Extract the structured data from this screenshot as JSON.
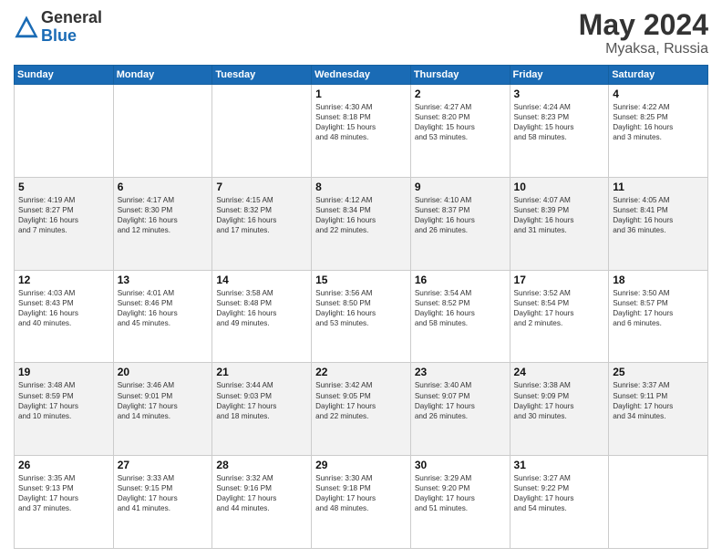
{
  "header": {
    "logo_general": "General",
    "logo_blue": "Blue",
    "month_year": "May 2024",
    "location": "Myaksa, Russia"
  },
  "days_of_week": [
    "Sunday",
    "Monday",
    "Tuesday",
    "Wednesday",
    "Thursday",
    "Friday",
    "Saturday"
  ],
  "weeks": [
    [
      {
        "day": "",
        "info": ""
      },
      {
        "day": "",
        "info": ""
      },
      {
        "day": "",
        "info": ""
      },
      {
        "day": "1",
        "info": "Sunrise: 4:30 AM\nSunset: 8:18 PM\nDaylight: 15 hours\nand 48 minutes."
      },
      {
        "day": "2",
        "info": "Sunrise: 4:27 AM\nSunset: 8:20 PM\nDaylight: 15 hours\nand 53 minutes."
      },
      {
        "day": "3",
        "info": "Sunrise: 4:24 AM\nSunset: 8:23 PM\nDaylight: 15 hours\nand 58 minutes."
      },
      {
        "day": "4",
        "info": "Sunrise: 4:22 AM\nSunset: 8:25 PM\nDaylight: 16 hours\nand 3 minutes."
      }
    ],
    [
      {
        "day": "5",
        "info": "Sunrise: 4:19 AM\nSunset: 8:27 PM\nDaylight: 16 hours\nand 7 minutes."
      },
      {
        "day": "6",
        "info": "Sunrise: 4:17 AM\nSunset: 8:30 PM\nDaylight: 16 hours\nand 12 minutes."
      },
      {
        "day": "7",
        "info": "Sunrise: 4:15 AM\nSunset: 8:32 PM\nDaylight: 16 hours\nand 17 minutes."
      },
      {
        "day": "8",
        "info": "Sunrise: 4:12 AM\nSunset: 8:34 PM\nDaylight: 16 hours\nand 22 minutes."
      },
      {
        "day": "9",
        "info": "Sunrise: 4:10 AM\nSunset: 8:37 PM\nDaylight: 16 hours\nand 26 minutes."
      },
      {
        "day": "10",
        "info": "Sunrise: 4:07 AM\nSunset: 8:39 PM\nDaylight: 16 hours\nand 31 minutes."
      },
      {
        "day": "11",
        "info": "Sunrise: 4:05 AM\nSunset: 8:41 PM\nDaylight: 16 hours\nand 36 minutes."
      }
    ],
    [
      {
        "day": "12",
        "info": "Sunrise: 4:03 AM\nSunset: 8:43 PM\nDaylight: 16 hours\nand 40 minutes."
      },
      {
        "day": "13",
        "info": "Sunrise: 4:01 AM\nSunset: 8:46 PM\nDaylight: 16 hours\nand 45 minutes."
      },
      {
        "day": "14",
        "info": "Sunrise: 3:58 AM\nSunset: 8:48 PM\nDaylight: 16 hours\nand 49 minutes."
      },
      {
        "day": "15",
        "info": "Sunrise: 3:56 AM\nSunset: 8:50 PM\nDaylight: 16 hours\nand 53 minutes."
      },
      {
        "day": "16",
        "info": "Sunrise: 3:54 AM\nSunset: 8:52 PM\nDaylight: 16 hours\nand 58 minutes."
      },
      {
        "day": "17",
        "info": "Sunrise: 3:52 AM\nSunset: 8:54 PM\nDaylight: 17 hours\nand 2 minutes."
      },
      {
        "day": "18",
        "info": "Sunrise: 3:50 AM\nSunset: 8:57 PM\nDaylight: 17 hours\nand 6 minutes."
      }
    ],
    [
      {
        "day": "19",
        "info": "Sunrise: 3:48 AM\nSunset: 8:59 PM\nDaylight: 17 hours\nand 10 minutes."
      },
      {
        "day": "20",
        "info": "Sunrise: 3:46 AM\nSunset: 9:01 PM\nDaylight: 17 hours\nand 14 minutes."
      },
      {
        "day": "21",
        "info": "Sunrise: 3:44 AM\nSunset: 9:03 PM\nDaylight: 17 hours\nand 18 minutes."
      },
      {
        "day": "22",
        "info": "Sunrise: 3:42 AM\nSunset: 9:05 PM\nDaylight: 17 hours\nand 22 minutes."
      },
      {
        "day": "23",
        "info": "Sunrise: 3:40 AM\nSunset: 9:07 PM\nDaylight: 17 hours\nand 26 minutes."
      },
      {
        "day": "24",
        "info": "Sunrise: 3:38 AM\nSunset: 9:09 PM\nDaylight: 17 hours\nand 30 minutes."
      },
      {
        "day": "25",
        "info": "Sunrise: 3:37 AM\nSunset: 9:11 PM\nDaylight: 17 hours\nand 34 minutes."
      }
    ],
    [
      {
        "day": "26",
        "info": "Sunrise: 3:35 AM\nSunset: 9:13 PM\nDaylight: 17 hours\nand 37 minutes."
      },
      {
        "day": "27",
        "info": "Sunrise: 3:33 AM\nSunset: 9:15 PM\nDaylight: 17 hours\nand 41 minutes."
      },
      {
        "day": "28",
        "info": "Sunrise: 3:32 AM\nSunset: 9:16 PM\nDaylight: 17 hours\nand 44 minutes."
      },
      {
        "day": "29",
        "info": "Sunrise: 3:30 AM\nSunset: 9:18 PM\nDaylight: 17 hours\nand 48 minutes."
      },
      {
        "day": "30",
        "info": "Sunrise: 3:29 AM\nSunset: 9:20 PM\nDaylight: 17 hours\nand 51 minutes."
      },
      {
        "day": "31",
        "info": "Sunrise: 3:27 AM\nSunset: 9:22 PM\nDaylight: 17 hours\nand 54 minutes."
      },
      {
        "day": "",
        "info": ""
      }
    ]
  ]
}
